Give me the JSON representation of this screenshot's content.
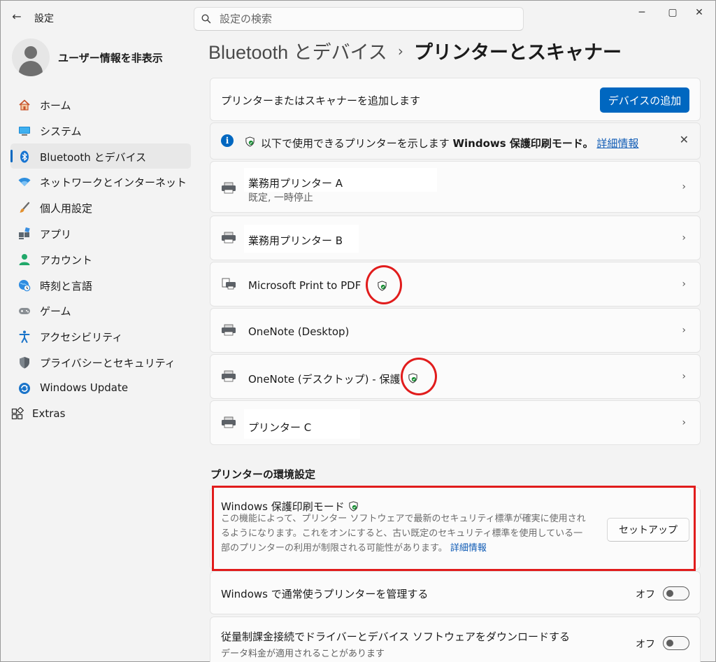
{
  "window": {
    "title": "設定",
    "back_icon": "arrow-left-icon",
    "minimize_glyph": "─",
    "maximize_glyph": "▢",
    "close_glyph": "✕"
  },
  "search": {
    "placeholder": "設定の検索"
  },
  "user": {
    "name": "ユーザー情報を非表示"
  },
  "sidebar": {
    "items": [
      {
        "label": "ホーム",
        "icon": "home-icon"
      },
      {
        "label": "システム",
        "icon": "system-icon"
      },
      {
        "label": "Bluetooth とデバイス",
        "icon": "bluetooth-icon",
        "active": true
      },
      {
        "label": "ネットワークとインターネット",
        "icon": "wifi-icon"
      },
      {
        "label": "個人用設定",
        "icon": "brush-icon"
      },
      {
        "label": "アプリ",
        "icon": "apps-icon"
      },
      {
        "label": "アカウント",
        "icon": "account-icon"
      },
      {
        "label": "時刻と言語",
        "icon": "globe-clock-icon"
      },
      {
        "label": "ゲーム",
        "icon": "gamepad-icon"
      },
      {
        "label": "アクセシビリティ",
        "icon": "accessibility-icon"
      },
      {
        "label": "プライバシーとセキュリティ",
        "icon": "shield-icon"
      },
      {
        "label": "Windows Update",
        "icon": "update-icon"
      },
      {
        "label": "Extras",
        "icon": "extras-icon"
      }
    ]
  },
  "breadcrumb": {
    "parent": "Bluetooth とデバイス",
    "separator": "›",
    "current": "プリンターとスキャナー"
  },
  "add_device": {
    "label": "プリンターまたはスキャナーを追加します",
    "button": "デバイスの追加"
  },
  "info_bar": {
    "text": "以下で使用できるプリンターを示します",
    "bold": "Windows 保護印刷モード。",
    "link": "詳細情報",
    "close_glyph": "✕"
  },
  "printers": [
    {
      "name": "業務用プリンター A",
      "status": "既定, 一時停止",
      "icon": "printer-icon"
    },
    {
      "name": "業務用プリンター B",
      "icon": "printer-icon"
    },
    {
      "name": "Microsoft Print to PDF",
      "icon": "pdf-printer-icon",
      "protected": true
    },
    {
      "name": "OneNote (Desktop)",
      "icon": "printer-icon"
    },
    {
      "name": "OneNote (デスクトップ) - 保護",
      "icon": "printer-icon",
      "protected": true
    },
    {
      "name": "プリンター C",
      "icon": "printer-icon"
    }
  ],
  "chevron_glyph": "›",
  "preferences": {
    "title": "プリンターの環境設定",
    "protected_mode": {
      "title": "Windows 保護印刷モード",
      "description": "この機能によって、プリンター ソフトウェアで最新のセキュリティ標準が確実に使用されるようになります。これをオンにすると、古い既定のセキュリティ標準を使用している一部のプリンターの利用が制限される可能性があります。",
      "link": "詳細情報",
      "button": "セットアップ"
    },
    "manage_default": {
      "title": "Windows で通常使うプリンターを管理する",
      "state": "オフ",
      "on": false
    },
    "metered": {
      "title": "従量制課金接続でドライバーとデバイス ソフトウェアをダウンロードする",
      "subtitle": "データ料金が適用されることがあります",
      "state": "オフ",
      "on": false
    }
  },
  "colors": {
    "accent": "#0067c0",
    "highlight": "#e11c1c",
    "shield_green": "#108a2d"
  }
}
